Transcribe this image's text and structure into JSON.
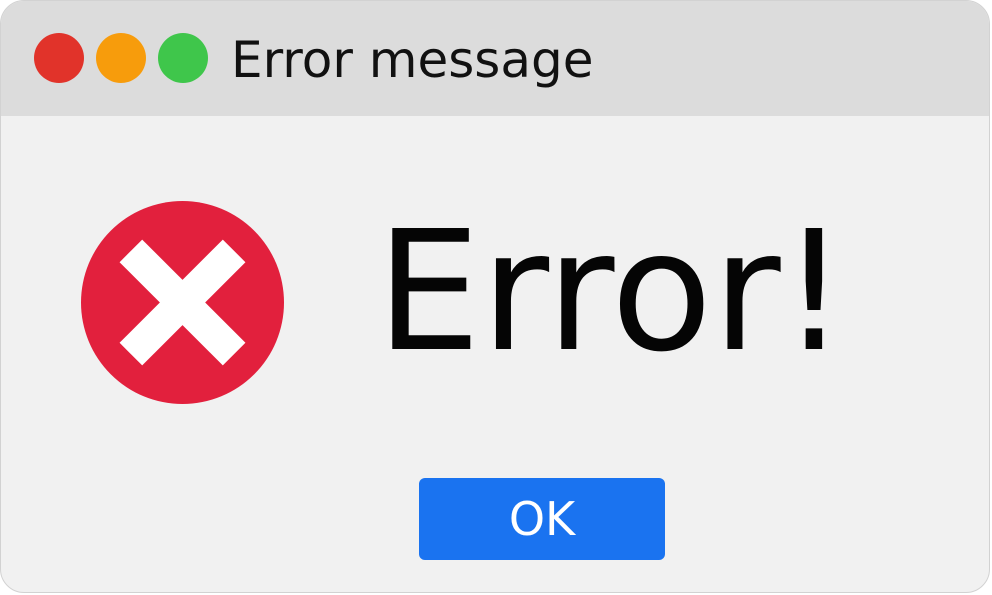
{
  "window": {
    "title": "Error message",
    "controls": {
      "close_color": "#e1332a",
      "minimize_color": "#f79c0c",
      "zoom_color": "#3fc64b"
    }
  },
  "dialog": {
    "icon": "error-x-icon",
    "icon_color": "#e2203d",
    "message": "Error!",
    "ok_label": "OK",
    "ok_color": "#1a73f0"
  }
}
